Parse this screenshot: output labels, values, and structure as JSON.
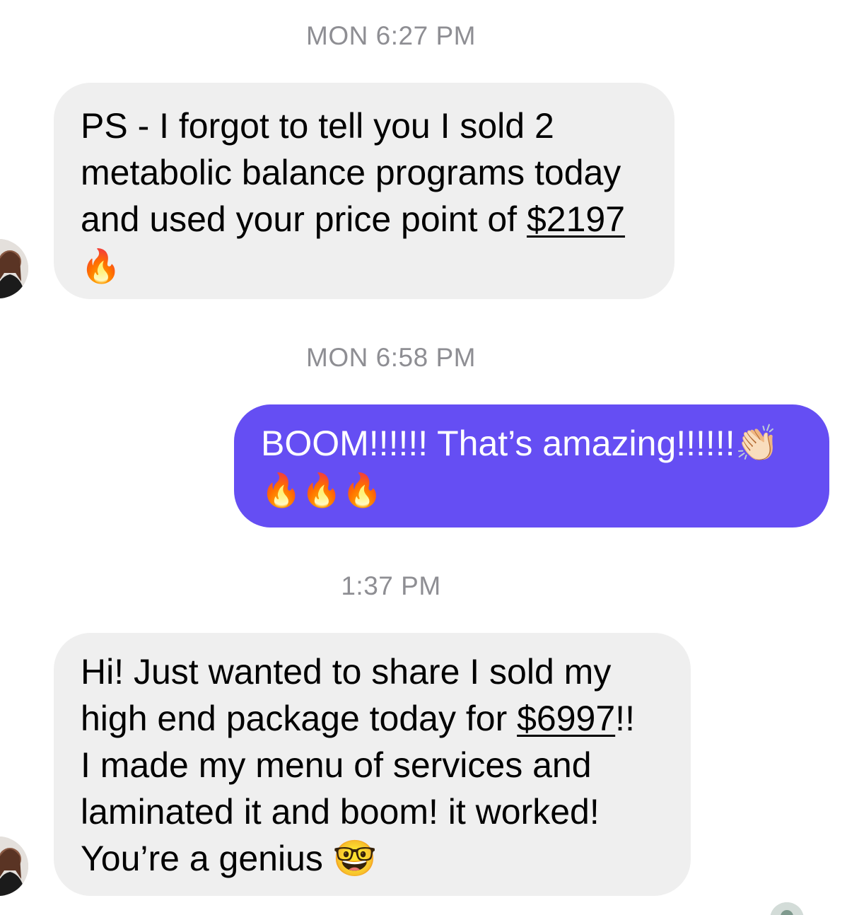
{
  "conversation": {
    "messages": [
      {
        "timestamp": "MON 6:27 PM",
        "sender": "contact",
        "lines": [
          "PS - I forgot to tell you I  sold 2",
          "metabolic balance programs today"
        ],
        "line3_prefix": "and used your price point of ",
        "line3_link": "$2197",
        "line4": "🔥"
      },
      {
        "timestamp": "MON 6:58 PM",
        "sender": "me",
        "line1": "BOOM!!!!!! That’s amazing!!!!!!👏🏻",
        "line2": "🔥🔥🔥"
      },
      {
        "timestamp": "1:37 PM",
        "sender": "contact",
        "line1": "Hi! Just wanted to share I sold my",
        "line2_prefix": "high end package today for ",
        "line2_link": "$6997",
        "line2_suffix": "!!",
        "line3": "I made my menu of services and",
        "line4": "laminated it and boom! it worked!",
        "line5": "You’re a genius 🤓"
      }
    ]
  },
  "colors": {
    "incoming_bubble": "#efefef",
    "outgoing_bubble": "#654ef3",
    "timestamp_text": "#8e8e93"
  }
}
